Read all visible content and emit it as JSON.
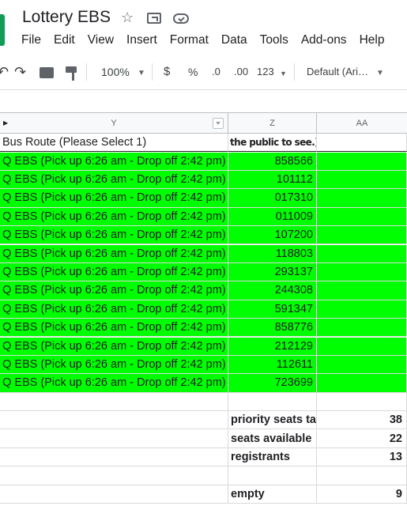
{
  "app": {
    "title": "Lottery EBS",
    "icons": [
      "star-icon",
      "move-to-folder-icon",
      "cloud-status-icon"
    ]
  },
  "menu": [
    "File",
    "Edit",
    "View",
    "Insert",
    "Format",
    "Data",
    "Tools",
    "Add-ons",
    "Help"
  ],
  "toolbar": {
    "zoom": "100%",
    "currency": "$",
    "percent": "%",
    "decrease_decimal": ".0",
    "increase_decimal": ".00",
    "more_formats": "123",
    "font": "Default (Ari…"
  },
  "columns": {
    "y": "Y",
    "z": "Z",
    "aa": "AA"
  },
  "header_row": {
    "y": "Bus Route (Please Select 1)",
    "z": "the public to see.)",
    "aa": ""
  },
  "rows": [
    {
      "route": "Q EBS (Pick up 6:26 am - Drop off 2:42 pm)",
      "code": "858566"
    },
    {
      "route": "Q EBS (Pick up 6:26 am - Drop off 2:42 pm)",
      "code": "101112"
    },
    {
      "route": "Q EBS (Pick up 6:26 am - Drop off 2:42 pm)",
      "code": "017310"
    },
    {
      "route": "Q EBS (Pick up 6:26 am - Drop off 2:42 pm)",
      "code": "011009"
    },
    {
      "route": "Q EBS (Pick up 6:26 am - Drop off 2:42 pm)",
      "code": "107200"
    },
    {
      "route": "Q EBS (Pick up 6:26 am - Drop off 2:42 pm)",
      "code": "118803"
    },
    {
      "route": "Q EBS (Pick up 6:26 am - Drop off 2:42 pm)",
      "code": "293137"
    },
    {
      "route": "Q EBS (Pick up 6:26 am - Drop off 2:42 pm)",
      "code": "244308"
    },
    {
      "route": "Q EBS (Pick up 6:26 am - Drop off 2:42 pm)",
      "code": "591347"
    },
    {
      "route": "Q EBS (Pick up 6:26 am - Drop off 2:42 pm)",
      "code": "858776"
    },
    {
      "route": "Q EBS (Pick up 6:26 am - Drop off 2:42 pm)",
      "code": "212129"
    },
    {
      "route": "Q EBS (Pick up 6:26 am - Drop off 2:42 pm)",
      "code": "112611"
    },
    {
      "route": "Q EBS (Pick up 6:26 am - Drop off 2:42 pm)",
      "code": "723699"
    }
  ],
  "stats": [
    {
      "label": "",
      "value": ""
    },
    {
      "label": "priority seats ta",
      "value": "38"
    },
    {
      "label": "seats available",
      "value": "22"
    },
    {
      "label": "registrants",
      "value": "13"
    },
    {
      "label": "",
      "value": ""
    },
    {
      "label": "empty",
      "value": "9"
    }
  ],
  "colors": {
    "highlight": "#00ff00",
    "brand": "#0f9d58"
  }
}
